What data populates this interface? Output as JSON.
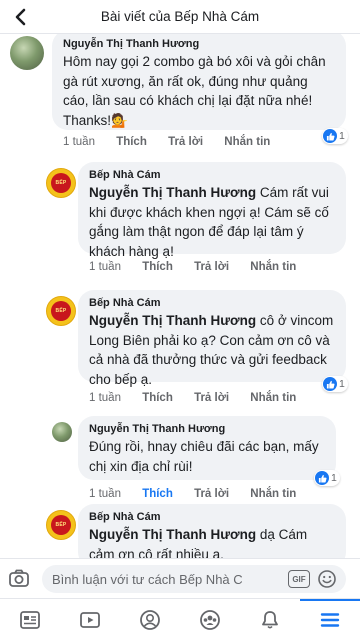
{
  "header": {
    "title": "Bài viết của Bếp Nhà Cám"
  },
  "comments": [
    {
      "author": "Nguyễn Thị Thanh Hương",
      "text": "Hôm nay gọi 2 combo gà bó xôi và gỏi chân gà rút xương, ăn rất ok, đúng như quảng cáo, lần sau có khách chị lại đặt nữa nhé! Thanks!💁",
      "time": "1 tuần",
      "like": "Thích",
      "reply": "Trả lời",
      "message": "Nhắn tin",
      "reaction_count": "1"
    },
    {
      "author": "Bếp Nhà Cám",
      "mention": "Nguyễn Thị Thanh Hương",
      "text": " Cám rất vui khi được khách khen ngợi ạ! Cám sẽ cố gắng làm thật ngon để đáp lại tâm ý khách hàng ạ!",
      "time": "1 tuần",
      "like": "Thích",
      "reply": "Trả lời",
      "message": "Nhắn tin"
    },
    {
      "author": "Bếp Nhà Cám",
      "mention": "Nguyễn Thị Thanh Hương",
      "text": " cô ở vincom Long Biên phải ko ạ? Con cảm ơn cô và cả nhà đã thưởng thức và gửi feedback cho bếp ạ.",
      "time": "1 tuần",
      "like": "Thích",
      "reply": "Trả lời",
      "message": "Nhắn tin",
      "reaction_count": "1"
    },
    {
      "author": "Nguyễn Thị Thanh Hương",
      "text": "Đúng rồi, hnay chiêu đãi các bạn, mấy chị xin địa chỉ rùi!",
      "time": "1 tuần",
      "like": "Thích",
      "reply": "Trả lời",
      "message": "Nhắn tin",
      "reaction_count": "1"
    },
    {
      "author": "Bếp Nhà Cám",
      "mention": "Nguyễn Thị Thanh Hương",
      "text": " dạ Cám cảm ơn cô rất nhiều ạ."
    }
  ],
  "composer": {
    "placeholder": "Bình luận với tư cách Bếp Nhà Cám",
    "gif_label": "GIF"
  },
  "colors": {
    "accent": "#1877f2",
    "bubble": "#f0f2f5",
    "muted": "#65676b"
  },
  "tabs": [
    {
      "icon": "news-feed-icon"
    },
    {
      "icon": "watch-icon"
    },
    {
      "icon": "profile-icon"
    },
    {
      "icon": "groups-icon"
    },
    {
      "icon": "notifications-icon"
    },
    {
      "icon": "menu-icon",
      "active": true
    }
  ]
}
